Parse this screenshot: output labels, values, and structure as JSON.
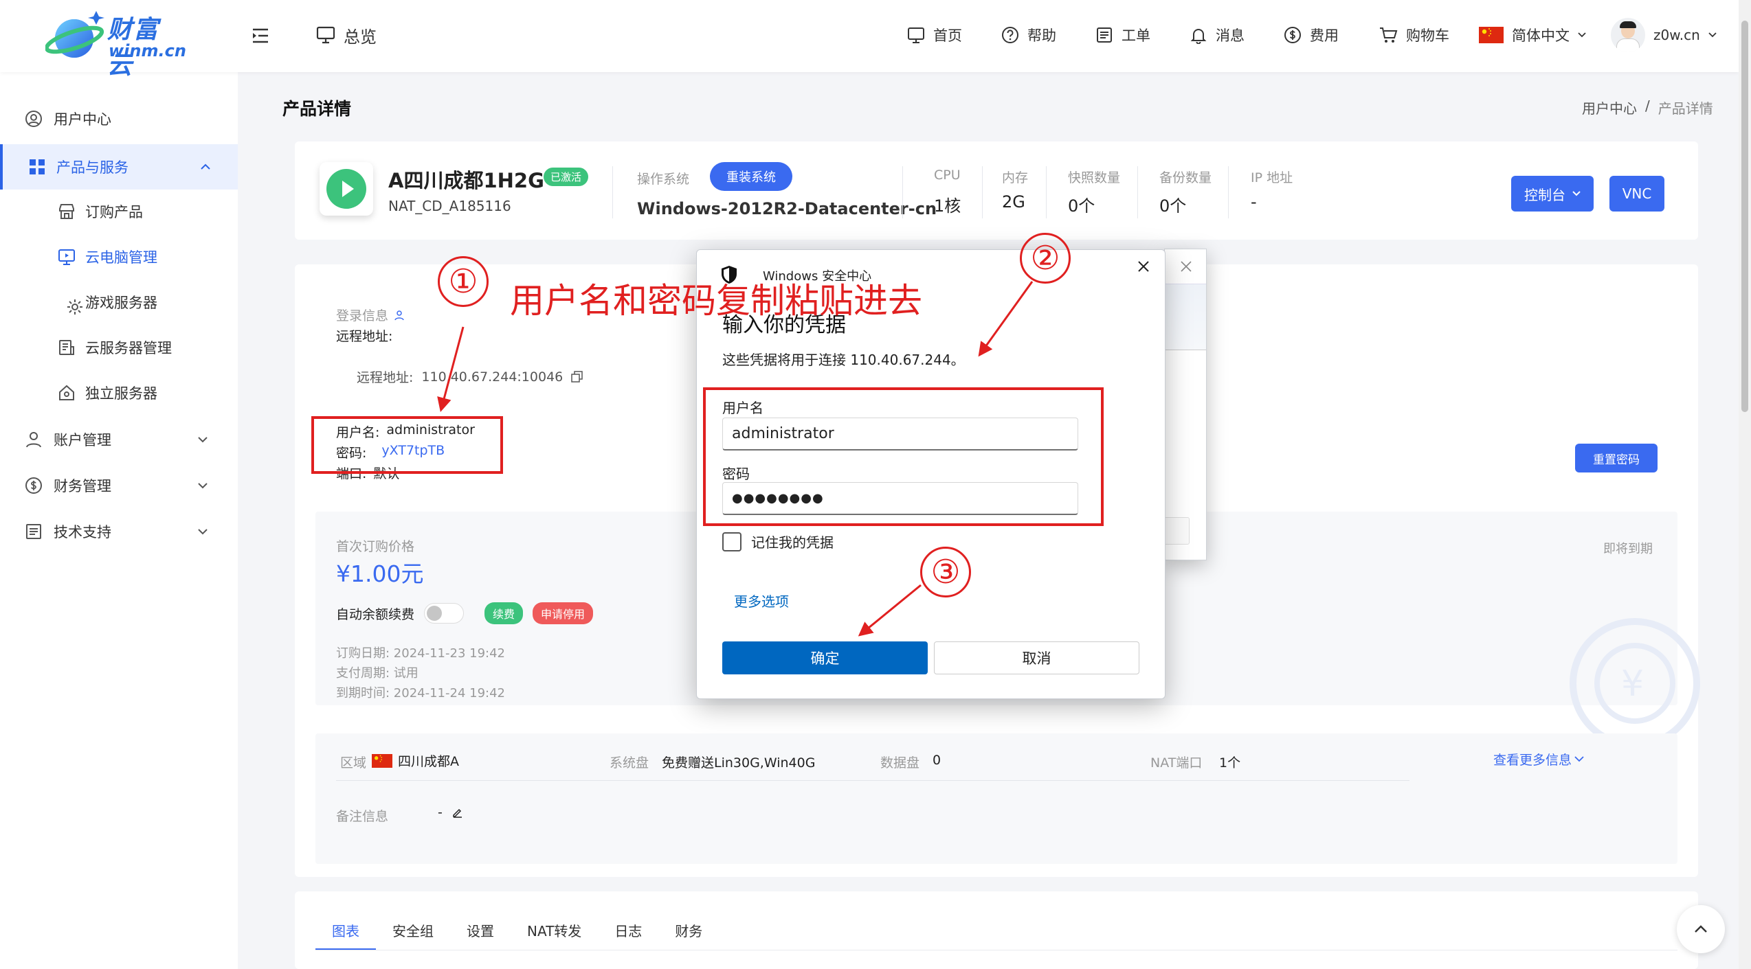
{
  "header": {
    "logo_text": "财富云",
    "logo_domain": "winm.cn",
    "overview_label": "总览",
    "nav": [
      {
        "label": "首页",
        "icon": "monitor-chat-icon"
      },
      {
        "label": "帮助",
        "icon": "help-circle-icon"
      },
      {
        "label": "工单",
        "icon": "ticket-icon"
      },
      {
        "label": "消息",
        "icon": "bell-icon"
      },
      {
        "label": "费用",
        "icon": "dollar-icon"
      },
      {
        "label": "购物车",
        "icon": "cart-icon"
      }
    ],
    "language": "简体中文",
    "user": "z0w.cn"
  },
  "sidebar": {
    "user_center": "用户中心",
    "products": "产品与服务",
    "sub": [
      "订购产品",
      "云电脑管理",
      "游戏服务器",
      "云服务器管理",
      "独立服务器"
    ],
    "account": "账户管理",
    "finance": "财务管理",
    "support": "技术支持"
  },
  "page": {
    "title": "产品详情",
    "breadcrumb_home": "用户中心",
    "breadcrumb_sep": "/",
    "breadcrumb_current": "产品详情"
  },
  "product": {
    "name": "A四川成都1H2G",
    "status": "已激活",
    "id": "NAT_CD_A185116",
    "os_label": "操作系统",
    "reinstall": "重装系统",
    "os_value": "Windows-2012R2-Datacenter-cn",
    "specs": [
      {
        "label": "CPU",
        "value": "1核"
      },
      {
        "label": "内存",
        "value": "2G"
      },
      {
        "label": "快照数量",
        "value": "0个"
      },
      {
        "label": "备份数量",
        "value": "0个"
      },
      {
        "label": "IP 地址",
        "value": "-"
      }
    ],
    "console": "控制台",
    "vnc": "VNC"
  },
  "login": {
    "title": "登录信息",
    "remote_addr_label": "远程地址:",
    "remote_addr_line_label": "远程地址:",
    "remote_addr_value": "110.40.67.244:10046",
    "username_label": "用户名:",
    "username": "administrator",
    "password_label": "密码:",
    "password": "yXT7tpTB",
    "port_label": "端口:",
    "port": "默认",
    "reset_password": "重置密码"
  },
  "billing": {
    "first_price_label": "首次订购价格",
    "first_price": "¥1.00元",
    "auto_renew": "自动余额续费",
    "renew_tag": "续费",
    "stop_tag": "申请停用",
    "order_date": "订购日期:  2024-11-23 19:42",
    "pay_cycle": "支付周期:  试用",
    "expire_date": "到期时间:  2024-11-24 19:42",
    "expiring": "即将到期"
  },
  "info": {
    "region_label": "区域",
    "region": "四川成都A",
    "sysdisk_label": "系统盘",
    "sysdisk": "免费赠送Lin30G,Win40G",
    "datadisk_label": "数据盘",
    "datadisk": "0",
    "nat_label": "NAT端口",
    "nat": "1个",
    "more": "查看更多信息",
    "remark_label": "备注信息",
    "remark": "-"
  },
  "tabs": [
    "图表",
    "安全组",
    "设置",
    "NAT转发",
    "日志",
    "财务"
  ],
  "dialog": {
    "app_title": "Windows 安全中心",
    "heading": "输入你的凭据",
    "desc": "这些凭据将用于连接 110.40.67.244。",
    "username_label": "用户名",
    "username_value": "administrator",
    "password_label": "密码",
    "password_value": "●●●●●●●●",
    "remember": "记住我的凭据",
    "more_options": "更多选项",
    "ok": "确定",
    "cancel": "取消"
  },
  "annotations": {
    "step1": "①",
    "step2": "②",
    "step3": "③",
    "instruction": "用户名和密码复制粘贴进去"
  },
  "colors": {
    "primary": "#3a6af0",
    "green": "#3cc37c",
    "red_tag": "#ef5a5a",
    "annotation_red": "#e02020",
    "win_blue": "#0067c0"
  }
}
